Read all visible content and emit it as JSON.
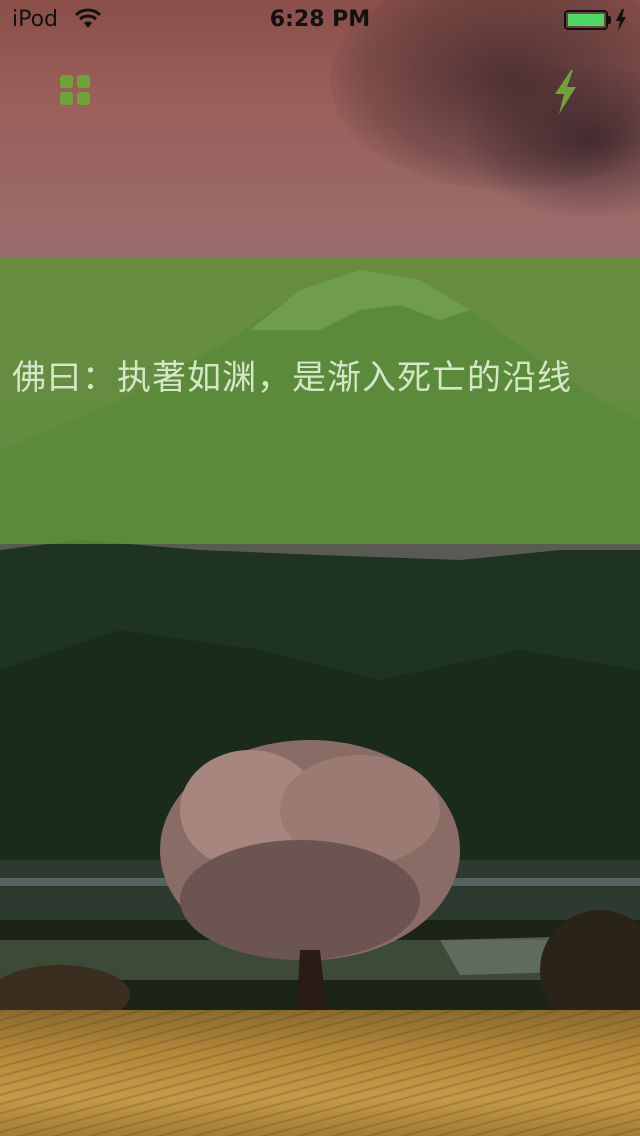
{
  "status_bar": {
    "carrier": "iPod",
    "time": "6:28 PM"
  },
  "nav": {
    "menu_icon": "grid-icon",
    "flash_icon": "lightning-icon"
  },
  "quote": {
    "text": "佛曰：执著如渊，是渐入死亡的沿线"
  },
  "colors": {
    "accent": "#6fa33a",
    "quote_band": "#5c9634",
    "quote_text": "#d6e6c8",
    "battery": "#4cd964"
  }
}
